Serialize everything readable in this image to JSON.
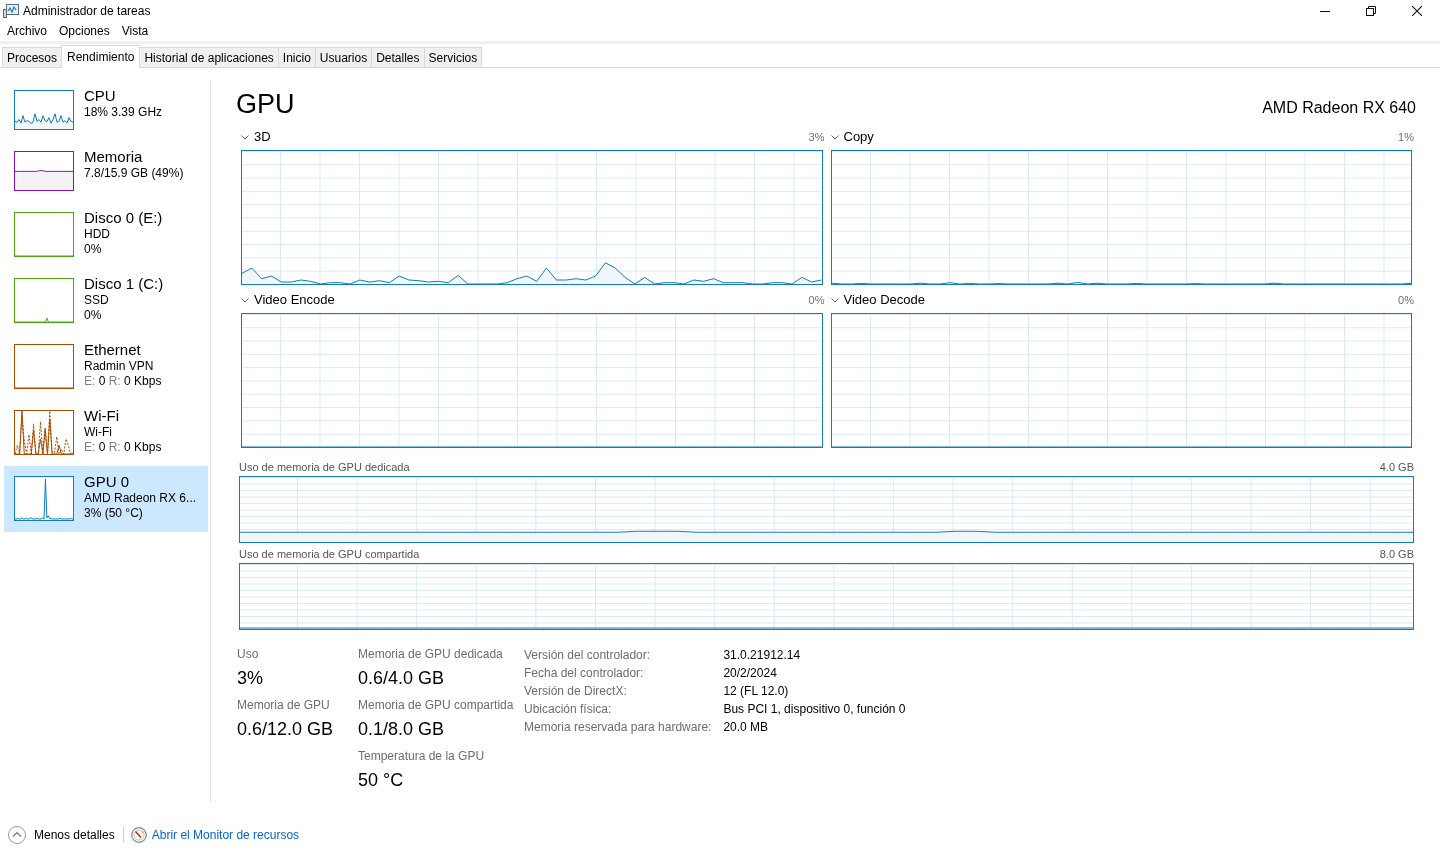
{
  "window": {
    "title": "Administrador de tareas"
  },
  "menu": [
    {
      "label": "Archivo"
    },
    {
      "label": "Opciones"
    },
    {
      "label": "Vista"
    }
  ],
  "tabs": [
    {
      "label": "Procesos",
      "selected": false
    },
    {
      "label": "Rendimiento",
      "selected": true
    },
    {
      "label": "Historial de aplicaciones",
      "selected": false
    },
    {
      "label": "Inicio",
      "selected": false
    },
    {
      "label": "Usuarios",
      "selected": false
    },
    {
      "label": "Detalles",
      "selected": false
    },
    {
      "label": "Servicios",
      "selected": false
    }
  ],
  "sidebar": {
    "items": [
      {
        "title": "CPU",
        "lines": [
          "18% 3.39 GHz"
        ],
        "color": "#117dbb",
        "selected": false
      },
      {
        "title": "Memoria",
        "lines": [
          "7.8/15.9 GB (49%)"
        ],
        "color": "#8b12ae",
        "selected": false
      },
      {
        "title": "Disco 0 (E:)",
        "lines": [
          "HDD",
          "0%"
        ],
        "color": "#4da60c",
        "selected": false
      },
      {
        "title": "Disco 1 (C:)",
        "lines": [
          "SSD",
          "0%"
        ],
        "color": "#4da60c",
        "selected": false
      },
      {
        "title": "Ethernet",
        "lines": [
          "Radmin VPN"
        ],
        "throughput": [
          {
            "label": "E:",
            "value": "0"
          },
          {
            "label": "R:",
            "value": "0 Kbps"
          }
        ],
        "color": "#a74f01",
        "selected": false
      },
      {
        "title": "Wi-Fi",
        "lines": [
          "Wi-Fi"
        ],
        "throughput": [
          {
            "label": "E:",
            "value": "0"
          },
          {
            "label": "R:",
            "value": "0 Kbps"
          }
        ],
        "color": "#a74f01",
        "selected": false
      },
      {
        "title": "GPU 0",
        "lines": [
          "AMD Radeon RX 6...",
          "3% (50 °C)"
        ],
        "color": "#117dbb",
        "selected": true
      }
    ]
  },
  "detail": {
    "title": "GPU",
    "device": "AMD Radeon RX 640",
    "engines": [
      {
        "name": "3D",
        "reading": "3%"
      },
      {
        "name": "Copy",
        "reading": "1%"
      },
      {
        "name": "Video Encode",
        "reading": "0%"
      },
      {
        "name": "Video Decode",
        "reading": "0%"
      }
    ],
    "memory_graphs": [
      {
        "label": "Uso de memoria de GPU dedicada",
        "max": "4.0 GB"
      },
      {
        "label": "Uso de memoria de GPU compartida",
        "max": "8.0 GB"
      }
    ],
    "stat_columns": [
      {
        "stats": [
          {
            "label": "Uso",
            "value": "3%"
          },
          {
            "label": "Memoria de GPU",
            "value": "0.6/12.0 GB"
          }
        ]
      },
      {
        "stats": [
          {
            "label": "Memoria de GPU dedicada",
            "value": "0.6/4.0 GB"
          },
          {
            "label": "Memoria de GPU compartida",
            "value": "0.1/8.0 GB"
          },
          {
            "label": "Temperatura de la GPU",
            "value": "50 °C"
          }
        ]
      }
    ],
    "properties": [
      {
        "label": "Versión del controlador:",
        "value": "31.0.21912.14"
      },
      {
        "label": "Fecha del controlador:",
        "value": "20/2/2024"
      },
      {
        "label": "Versión de DirectX:",
        "value": "12 (FL 12.0)"
      },
      {
        "label": "Ubicación física:",
        "value": "Bus PCI 1, dispositivo 0, función 0"
      },
      {
        "label": "Memoria reservada para hardware:",
        "value": "20.0 MB"
      }
    ]
  },
  "footer": {
    "fewer_details": "Menos detalles",
    "resource_monitor": "Abrir el Monitor de recursos"
  }
}
